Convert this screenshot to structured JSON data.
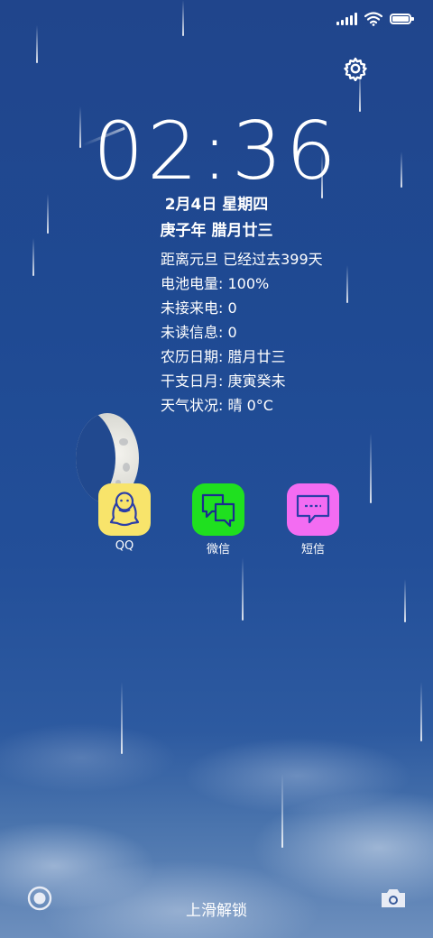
{
  "status_bar": {
    "signal_icon": "signal-icon",
    "wifi_icon": "wifi-icon",
    "battery_icon": "battery-icon",
    "battery_level_percent": 100
  },
  "settings_icon": "gear-icon",
  "clock": {
    "time": "02:36"
  },
  "date": {
    "line1": "2月4日 星期四",
    "line2": "庚子年 腊月廿三"
  },
  "info_lines": [
    "距离元旦 已经过去399天",
    "电池电量: 100%",
    "未接来电: 0",
    "未读信息: 0",
    "农历日期: 腊月廿三",
    "干支日月: 庚寅癸未",
    "天气状况: 晴 0°C"
  ],
  "apps": [
    {
      "label": "QQ",
      "icon": "penguin-icon",
      "color": "#f8e46b"
    },
    {
      "label": "微信",
      "icon": "chat-bubbles-icon",
      "color": "#1fe01f"
    },
    {
      "label": "短信",
      "icon": "message-icon",
      "color": "#f36cf2"
    }
  ],
  "bottom": {
    "left_icon": "circle-record-icon",
    "unlock_text": "上滑解锁",
    "camera_icon": "camera-icon"
  },
  "colors": {
    "sky_top": "#20458c",
    "sky_bottom": "#6d8fbd",
    "text": "#ffffff",
    "app_icon_stroke": "#2b3ea8"
  }
}
